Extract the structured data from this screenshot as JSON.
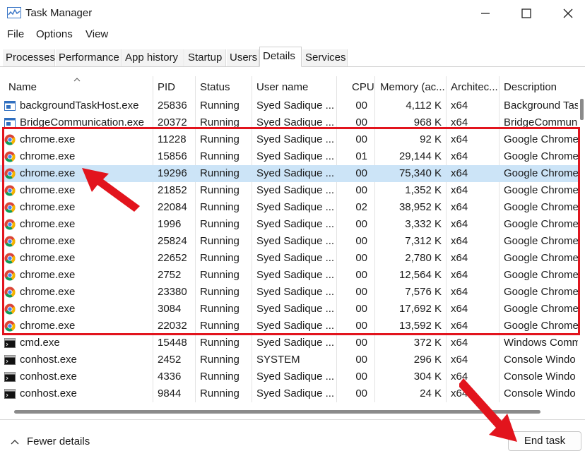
{
  "window": {
    "title": "Task Manager"
  },
  "menu": [
    "File",
    "Options",
    "View"
  ],
  "tabs": [
    {
      "label": "Processes"
    },
    {
      "label": "Performance"
    },
    {
      "label": "App history"
    },
    {
      "label": "Startup"
    },
    {
      "label": "Users"
    },
    {
      "label": "Details"
    },
    {
      "label": "Services"
    }
  ],
  "active_tab": "Details",
  "columns": [
    "Name",
    "PID",
    "Status",
    "User name",
    "CPU",
    "Memory (ac...",
    "Architec...",
    "Description"
  ],
  "rows": [
    {
      "icon": "task-host-icon",
      "name": "backgroundTaskHost.exe",
      "pid": "25836",
      "status": "Running",
      "user": "Syed Sadique ...",
      "cpu": "00",
      "memory": "4,112 K",
      "arch": "x64",
      "desc": "Background Tas"
    },
    {
      "icon": "task-host-icon",
      "name": "BridgeCommunication.exe",
      "pid": "20372",
      "status": "Running",
      "user": "Syed Sadique ...",
      "cpu": "00",
      "memory": "968 K",
      "arch": "x64",
      "desc": "BridgeCommun"
    },
    {
      "icon": "chrome-icon",
      "name": "chrome.exe",
      "pid": "11228",
      "status": "Running",
      "user": "Syed Sadique ...",
      "cpu": "00",
      "memory": "92 K",
      "arch": "x64",
      "desc": "Google Chrome"
    },
    {
      "icon": "chrome-icon",
      "name": "chrome.exe",
      "pid": "15856",
      "status": "Running",
      "user": "Syed Sadique ...",
      "cpu": "01",
      "memory": "29,144 K",
      "arch": "x64",
      "desc": "Google Chrome"
    },
    {
      "icon": "chrome-icon",
      "name": "chrome.exe",
      "pid": "19296",
      "status": "Running",
      "user": "Syed Sadique ...",
      "cpu": "00",
      "memory": "75,340 K",
      "arch": "x64",
      "desc": "Google Chrome",
      "selected": true
    },
    {
      "icon": "chrome-icon",
      "name": "chrome.exe",
      "pid": "21852",
      "status": "Running",
      "user": "Syed Sadique ...",
      "cpu": "00",
      "memory": "1,352 K",
      "arch": "x64",
      "desc": "Google Chrome"
    },
    {
      "icon": "chrome-icon",
      "name": "chrome.exe",
      "pid": "22084",
      "status": "Running",
      "user": "Syed Sadique ...",
      "cpu": "02",
      "memory": "38,952 K",
      "arch": "x64",
      "desc": "Google Chrome"
    },
    {
      "icon": "chrome-icon",
      "name": "chrome.exe",
      "pid": "1996",
      "status": "Running",
      "user": "Syed Sadique ...",
      "cpu": "00",
      "memory": "3,332 K",
      "arch": "x64",
      "desc": "Google Chrome"
    },
    {
      "icon": "chrome-icon",
      "name": "chrome.exe",
      "pid": "25824",
      "status": "Running",
      "user": "Syed Sadique ...",
      "cpu": "00",
      "memory": "7,312 K",
      "arch": "x64",
      "desc": "Google Chrome"
    },
    {
      "icon": "chrome-icon",
      "name": "chrome.exe",
      "pid": "22652",
      "status": "Running",
      "user": "Syed Sadique ...",
      "cpu": "00",
      "memory": "2,780 K",
      "arch": "x64",
      "desc": "Google Chrome"
    },
    {
      "icon": "chrome-icon",
      "name": "chrome.exe",
      "pid": "2752",
      "status": "Running",
      "user": "Syed Sadique ...",
      "cpu": "00",
      "memory": "12,564 K",
      "arch": "x64",
      "desc": "Google Chrome"
    },
    {
      "icon": "chrome-icon",
      "name": "chrome.exe",
      "pid": "23380",
      "status": "Running",
      "user": "Syed Sadique ...",
      "cpu": "00",
      "memory": "7,576 K",
      "arch": "x64",
      "desc": "Google Chrome"
    },
    {
      "icon": "chrome-icon",
      "name": "chrome.exe",
      "pid": "3084",
      "status": "Running",
      "user": "Syed Sadique ...",
      "cpu": "00",
      "memory": "17,692 K",
      "arch": "x64",
      "desc": "Google Chrome"
    },
    {
      "icon": "chrome-icon",
      "name": "chrome.exe",
      "pid": "22032",
      "status": "Running",
      "user": "Syed Sadique ...",
      "cpu": "00",
      "memory": "13,592 K",
      "arch": "x64",
      "desc": "Google Chrome"
    },
    {
      "icon": "console-icon",
      "name": "cmd.exe",
      "pid": "15448",
      "status": "Running",
      "user": "Syed Sadique ...",
      "cpu": "00",
      "memory": "372 K",
      "arch": "x64",
      "desc": "Windows Comm"
    },
    {
      "icon": "console-icon",
      "name": "conhost.exe",
      "pid": "2452",
      "status": "Running",
      "user": "SYSTEM",
      "cpu": "00",
      "memory": "296 K",
      "arch": "x64",
      "desc": "Console Windo"
    },
    {
      "icon": "console-icon",
      "name": "conhost.exe",
      "pid": "4336",
      "status": "Running",
      "user": "Syed Sadique ...",
      "cpu": "00",
      "memory": "304 K",
      "arch": "x64",
      "desc": "Console Windo"
    },
    {
      "icon": "console-icon",
      "name": "conhost.exe",
      "pid": "9844",
      "status": "Running",
      "user": "Syed Sadique ...",
      "cpu": "00",
      "memory": "24 K",
      "arch": "x64",
      "desc": "Console Windo"
    }
  ],
  "footer": {
    "fewer_details": "Fewer details",
    "end_task": "End task"
  },
  "colors": {
    "selected_row": "#cce4f7",
    "highlight": "#e2141d",
    "arrow": "#e2141d"
  }
}
